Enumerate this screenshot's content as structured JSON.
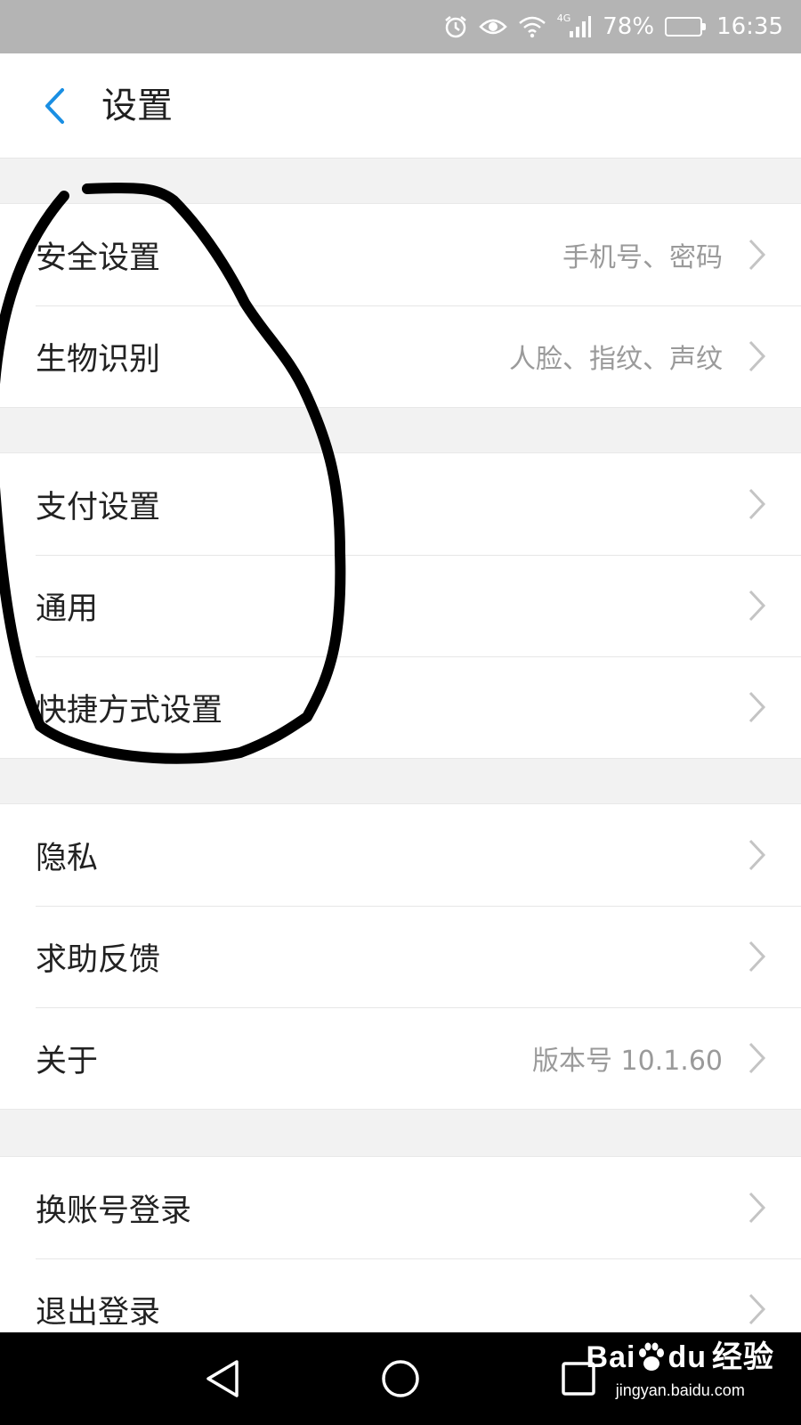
{
  "status_bar": {
    "network_type": "4G",
    "battery_percent": "78%",
    "battery_level": 0.78,
    "time": "16:35",
    "icons": [
      "alarm-icon",
      "eye-icon",
      "wifi-icon",
      "signal-icon",
      "battery-icon"
    ]
  },
  "header": {
    "back_icon": "chevron-left-icon",
    "title": "设置",
    "accent_color": "#1a8fe3"
  },
  "groups": [
    {
      "items": [
        {
          "label": "安全设置",
          "value": "手机号、密码"
        },
        {
          "label": "生物识别",
          "value": "人脸、指纹、声纹"
        }
      ]
    },
    {
      "items": [
        {
          "label": "支付设置",
          "value": ""
        },
        {
          "label": "通用",
          "value": ""
        },
        {
          "label": "快捷方式设置",
          "value": ""
        }
      ]
    },
    {
      "items": [
        {
          "label": "隐私",
          "value": ""
        },
        {
          "label": "求助反馈",
          "value": ""
        },
        {
          "label": "关于",
          "value": "版本号 10.1.60"
        }
      ]
    },
    {
      "items": [
        {
          "label": "换账号登录",
          "value": ""
        },
        {
          "label": "退出登录",
          "value": ""
        }
      ]
    }
  ],
  "nav_bar": {
    "icons": [
      "back-triangle-icon",
      "home-circle-icon",
      "recents-square-icon"
    ]
  },
  "watermark": {
    "logo_part1": "Bai",
    "logo_part2": "du",
    "logo_part3": "经验",
    "url": "jingyan.baidu.com"
  }
}
